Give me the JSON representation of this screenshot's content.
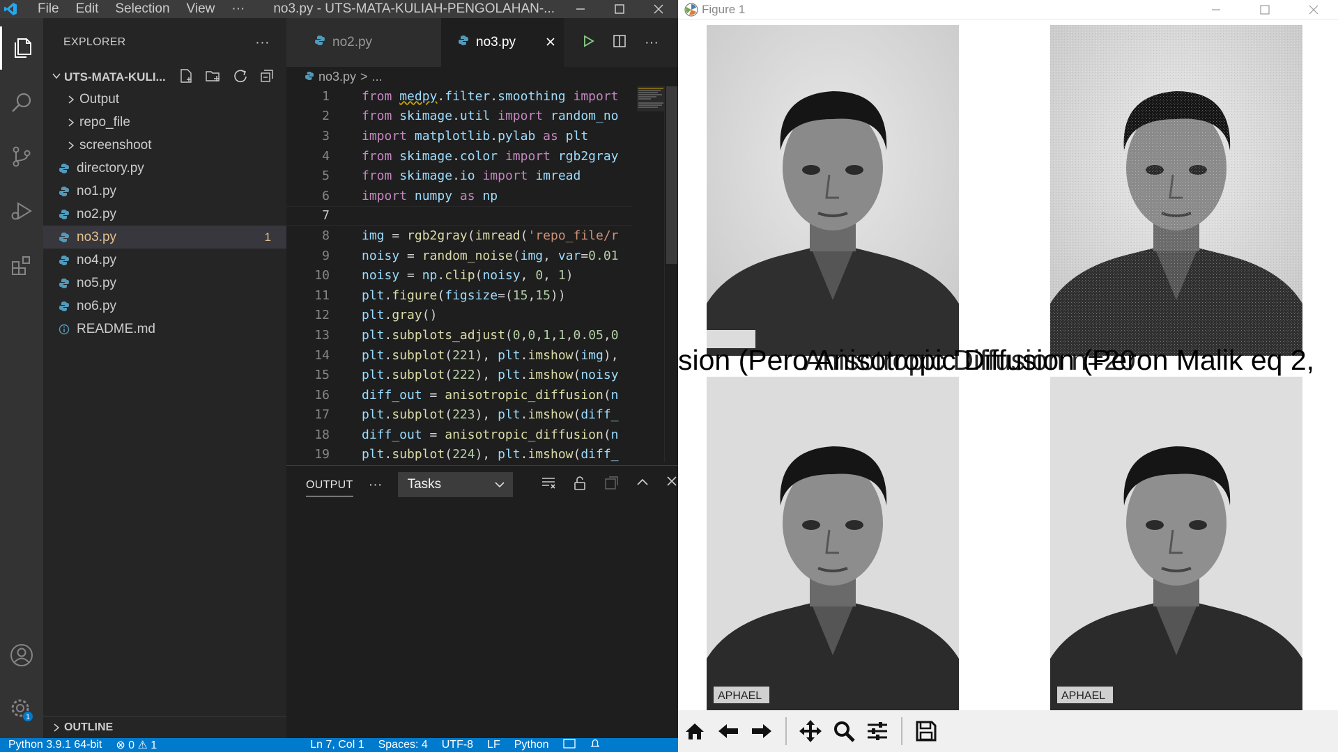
{
  "vscode": {
    "menu": [
      "File",
      "Edit",
      "Selection",
      "View",
      "···"
    ],
    "window_title": "no3.py - UTS-MATA-KULIAH-PENGOLAHAN-...",
    "explorer": {
      "header": "EXPLORER",
      "more": "···",
      "folder_name": "UTS-MATA-KULI...",
      "items": [
        {
          "label": "Output",
          "type": "folder"
        },
        {
          "label": "repo_file",
          "type": "folder"
        },
        {
          "label": "screenshoot",
          "type": "folder"
        },
        {
          "label": "directory.py",
          "type": "python"
        },
        {
          "label": "no1.py",
          "type": "python"
        },
        {
          "label": "no2.py",
          "type": "python"
        },
        {
          "label": "no3.py",
          "type": "python",
          "active": true,
          "badge": "1"
        },
        {
          "label": "no4.py",
          "type": "python"
        },
        {
          "label": "no5.py",
          "type": "python"
        },
        {
          "label": "no6.py",
          "type": "python"
        },
        {
          "label": "README.md",
          "type": "info"
        }
      ],
      "outline": "OUTLINE"
    },
    "tabs": [
      {
        "label": "no2.py",
        "active": false
      },
      {
        "label": "no3.py",
        "active": true
      }
    ],
    "breadcrumb": [
      "no3.py",
      ">",
      "..."
    ],
    "code_lines": [
      "from medpy.filter.smoothing import",
      "from skimage.util import random_no",
      "import matplotlib.pylab as plt",
      "from skimage.color import rgb2gray",
      "from skimage.io import imread",
      "import numpy as np",
      "",
      "img = rgb2gray(imread('repo_file/r",
      "noisy = random_noise(img, var=0.01",
      "noisy = np.clip(noisy, 0, 1)",
      "plt.figure(figsize=(15,15))",
      "plt.gray()",
      "plt.subplots_adjust(0,0,1,1,0.05,0",
      "plt.subplot(221), plt.imshow(img),",
      "plt.subplot(222), plt.imshow(noisy",
      "diff_out = anisotropic_diffusion(n",
      "plt.subplot(223), plt.imshow(diff_",
      "diff_out = anisotropic_diffusion(n",
      "plt.subplot(224), plt.imshow(diff_"
    ],
    "current_line": 7,
    "panel": {
      "tab": "OUTPUT",
      "more": "···",
      "tasks_value": "Tasks"
    },
    "status": {
      "interpreter": "Python 3.9.1 64-bit",
      "problems": "⊗ 0  ⚠ 1",
      "position": "Ln 7, Col 1",
      "spaces": "Spaces: 4",
      "encoding": "UTF-8",
      "eol": "LF",
      "language": "Python"
    },
    "accounts_badge": "1"
  },
  "figure": {
    "window_title": "Figure 1",
    "overlap_title": "sion (Pero Anisotropic Diffusion (Peron Malik eq 2,",
    "titles_ghost": "Anisotropic Diffusion n=20"
  }
}
